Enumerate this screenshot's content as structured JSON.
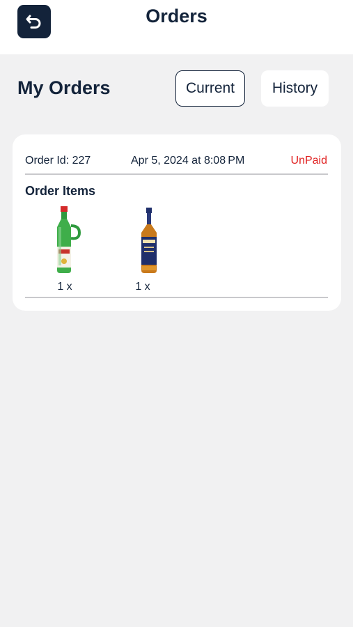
{
  "header": {
    "title": "Orders",
    "back_icon": "back-arrow-icon"
  },
  "page": {
    "heading": "My Orders"
  },
  "tabs": [
    {
      "label": "Current",
      "selected": true
    },
    {
      "label": "History",
      "selected": false
    }
  ],
  "orders": [
    {
      "id_text": "Order Id: 227",
      "date": "Apr 5, 2024 at 8:08 PM",
      "status": "UnPaid",
      "status_color": "#e02020",
      "items_heading": "Order Items",
      "items": [
        {
          "image": "green-gin-bottle",
          "qty": "1 x"
        },
        {
          "image": "whisky-bottle",
          "qty": "1 x"
        }
      ]
    }
  ],
  "colors": {
    "primary": "#13233a",
    "background": "#f1f1f2",
    "unpaid": "#e02020"
  }
}
